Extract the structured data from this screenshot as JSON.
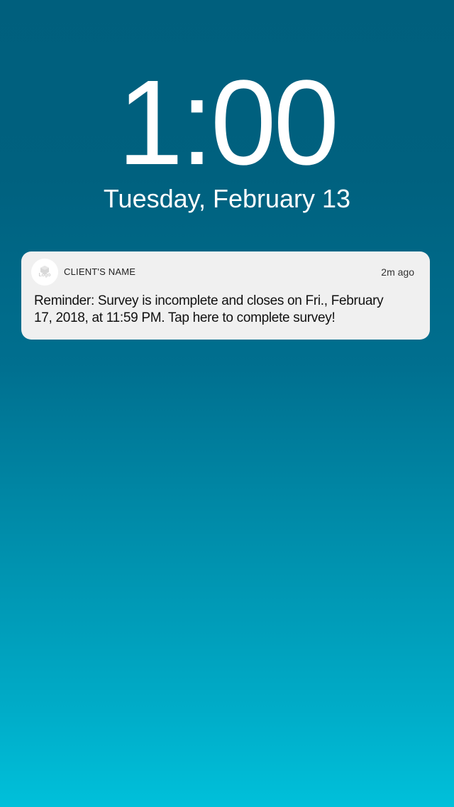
{
  "lock_screen": {
    "time": "1:00",
    "date": "Tuesday, February 13"
  },
  "notification": {
    "app_icon": {
      "icon": "logo-placeholder-icon",
      "label": "Logo"
    },
    "app_name": "CLIENT'S NAME",
    "timestamp": "2m ago",
    "message": "Reminder: Survey is incomplete and closes on Fri., February 17, 2018, at 11:59 PM. Tap here to complete survey!"
  },
  "colors": {
    "background_top": "#005f7d",
    "background_bottom": "#00c0da",
    "notification_bg": "#f0f0f0",
    "text_light": "#ffffff",
    "text_dark": "#111111"
  }
}
